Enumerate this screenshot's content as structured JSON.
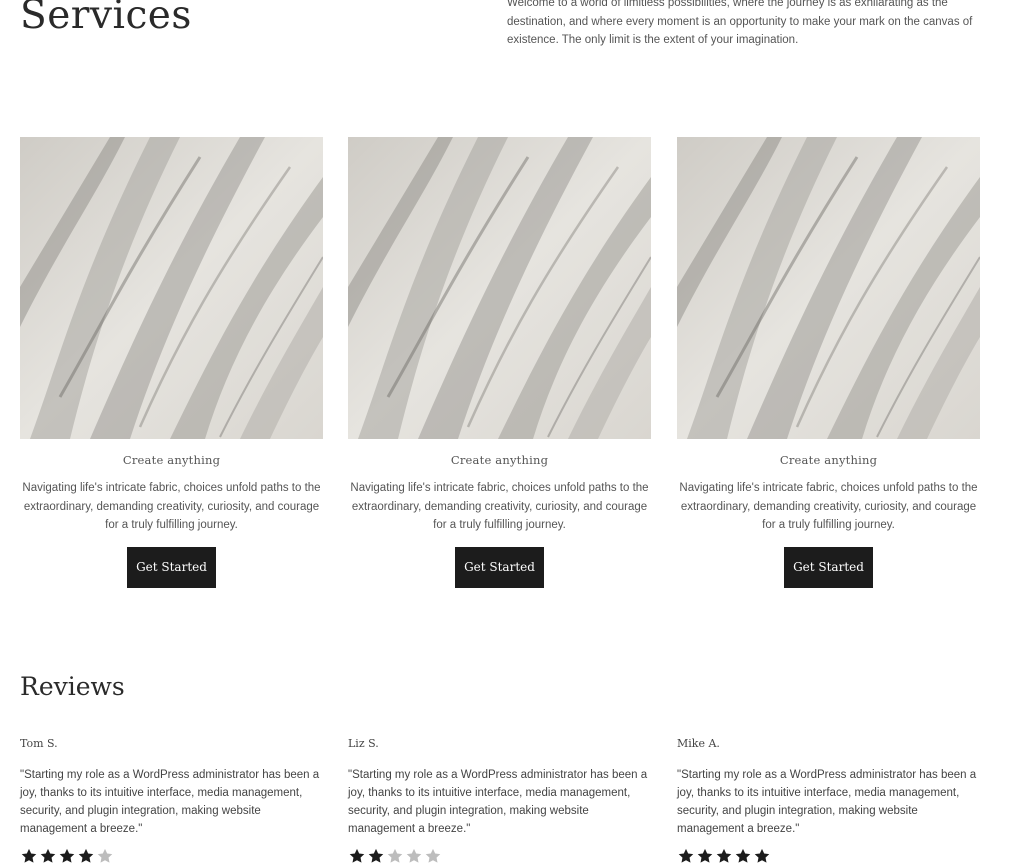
{
  "services": {
    "title": "Services",
    "intro": "Welcome to a world of limitless possibilities, where the journey is as exhilarating as the destination, and where every moment is an opportunity to make your mark on the canvas of existence. The only limit is the extent of your imagination.",
    "cards": [
      {
        "title": "Create anything",
        "description": "Navigating life's intricate fabric, choices unfold paths to the extraordinary, demanding creativity, curiosity, and courage for a truly fulfilling journey.",
        "button_label": "Get Started"
      },
      {
        "title": "Create anything",
        "description": "Navigating life's intricate fabric, choices unfold paths to the extraordinary, demanding creativity, curiosity, and courage for a truly fulfilling journey.",
        "button_label": "Get Started"
      },
      {
        "title": "Create anything",
        "description": "Navigating life's intricate fabric, choices unfold paths to the extraordinary, demanding creativity, curiosity, and courage for a truly fulfilling journey.",
        "button_label": "Get Started"
      }
    ]
  },
  "reviews": {
    "title": "Reviews",
    "items": [
      {
        "name": "Tom S.",
        "text": "\"Starting my role as a WordPress administrator has been a joy, thanks to its intuitive interface, media management, security, and plugin integration, making website management a breeze.\"",
        "rating": 4,
        "max_rating": 5
      },
      {
        "name": "Liz S.",
        "text": "\"Starting my role as a WordPress administrator has been a joy, thanks to its intuitive interface, media management, security, and plugin integration, making website management a breeze.\"",
        "rating": 2,
        "max_rating": 5
      },
      {
        "name": "Mike A.",
        "text": "\"Starting my role as a WordPress administrator has been a joy, thanks to its intuitive interface, media management, security, and plugin integration, making website management a breeze.\"",
        "rating": 5,
        "max_rating": 5
      }
    ]
  },
  "colors": {
    "button_bg": "#1c1c1c",
    "button_text": "#ffffff",
    "star_filled": "#1c1c1c",
    "star_empty": "#bdbdbd",
    "text": "#555555"
  },
  "icons": {
    "card_image": "abstract-sand-texture-image",
    "star": "star-icon"
  }
}
